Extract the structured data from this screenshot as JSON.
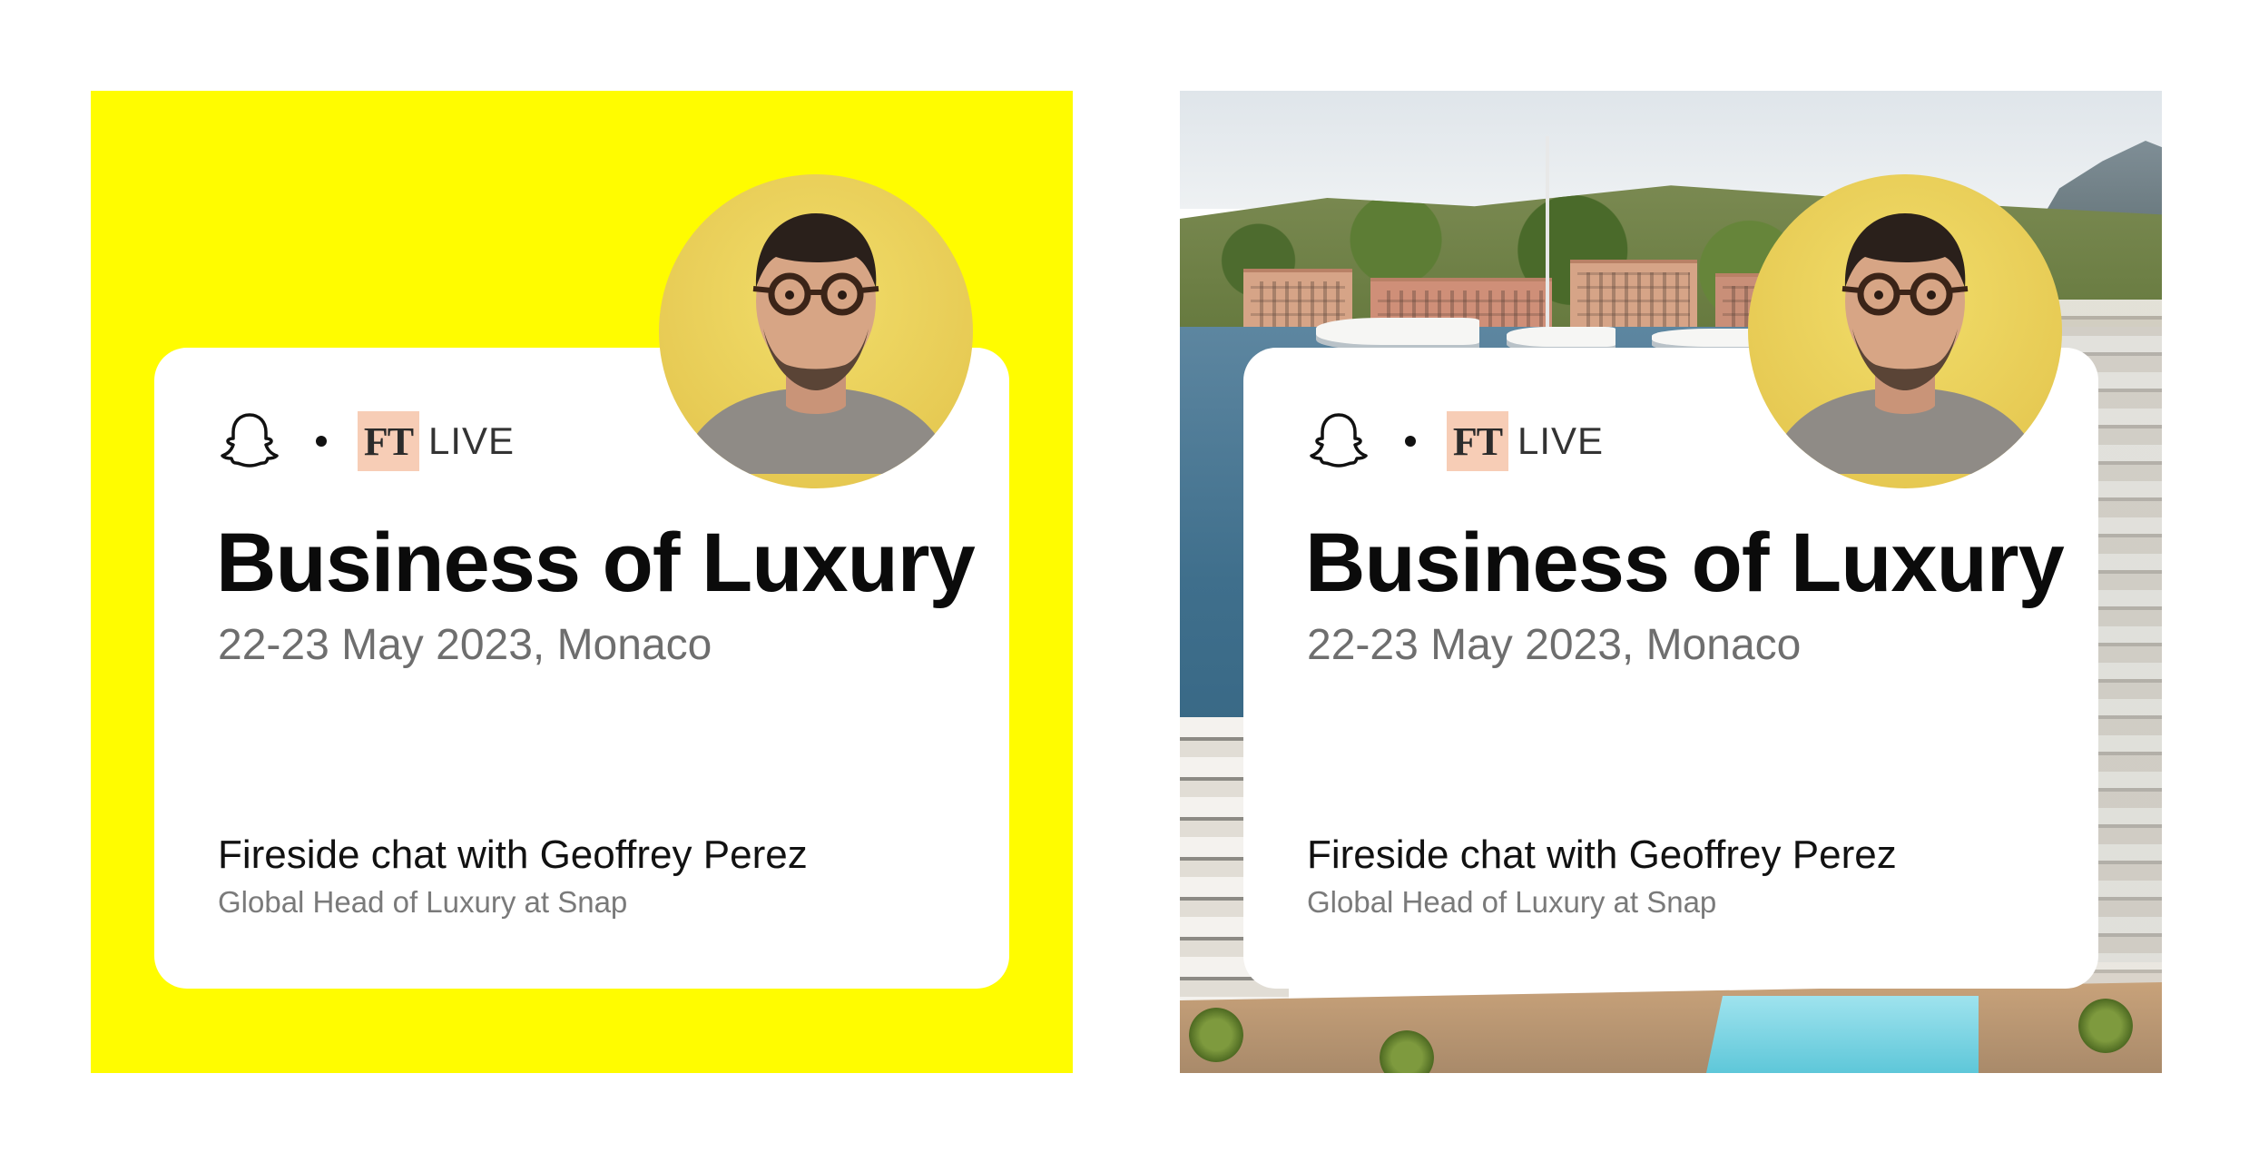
{
  "colors": {
    "brand": "#FFFC00",
    "ft_box": "#F7CDB6",
    "card": "#FFFFFF"
  },
  "panels": [
    {
      "background": "yellow",
      "card": {
        "icons": [
          "snapchat-ghost-icon"
        ],
        "ft_label": "FT",
        "live_label": "LIVE",
        "title": "Business of Luxury",
        "date": "22-23 May 2023, Monaco",
        "speaker": "Fireside chat with Geoffrey Perez",
        "role": "Global Head of Luxury at Snap"
      }
    },
    {
      "background": "monaco harbor photo",
      "card": {
        "icons": [
          "snapchat-ghost-icon"
        ],
        "ft_label": "FT",
        "live_label": "LIVE",
        "title": "Business of Luxury",
        "date": "22-23 May 2023, Monaco",
        "speaker": "Fireside chat with Geoffrey Perez",
        "role": "Global Head of Luxury at Snap"
      }
    }
  ]
}
